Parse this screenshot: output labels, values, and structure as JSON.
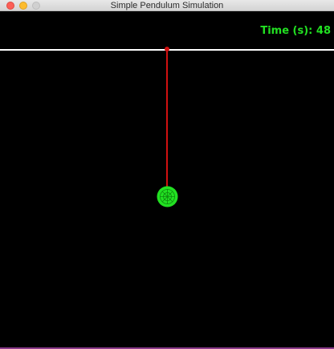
{
  "window": {
    "title": "Simple Pendulum Simulation"
  },
  "simulation": {
    "time_label": "Time (s): 48",
    "colors": {
      "background": "#000000",
      "ceiling": "#ffffff",
      "rod": "#d01010",
      "bob": "#22e022",
      "timer": "#22e022"
    }
  },
  "icons": {
    "close": "close-icon",
    "minimize": "minimize-icon",
    "zoom": "zoom-icon"
  }
}
